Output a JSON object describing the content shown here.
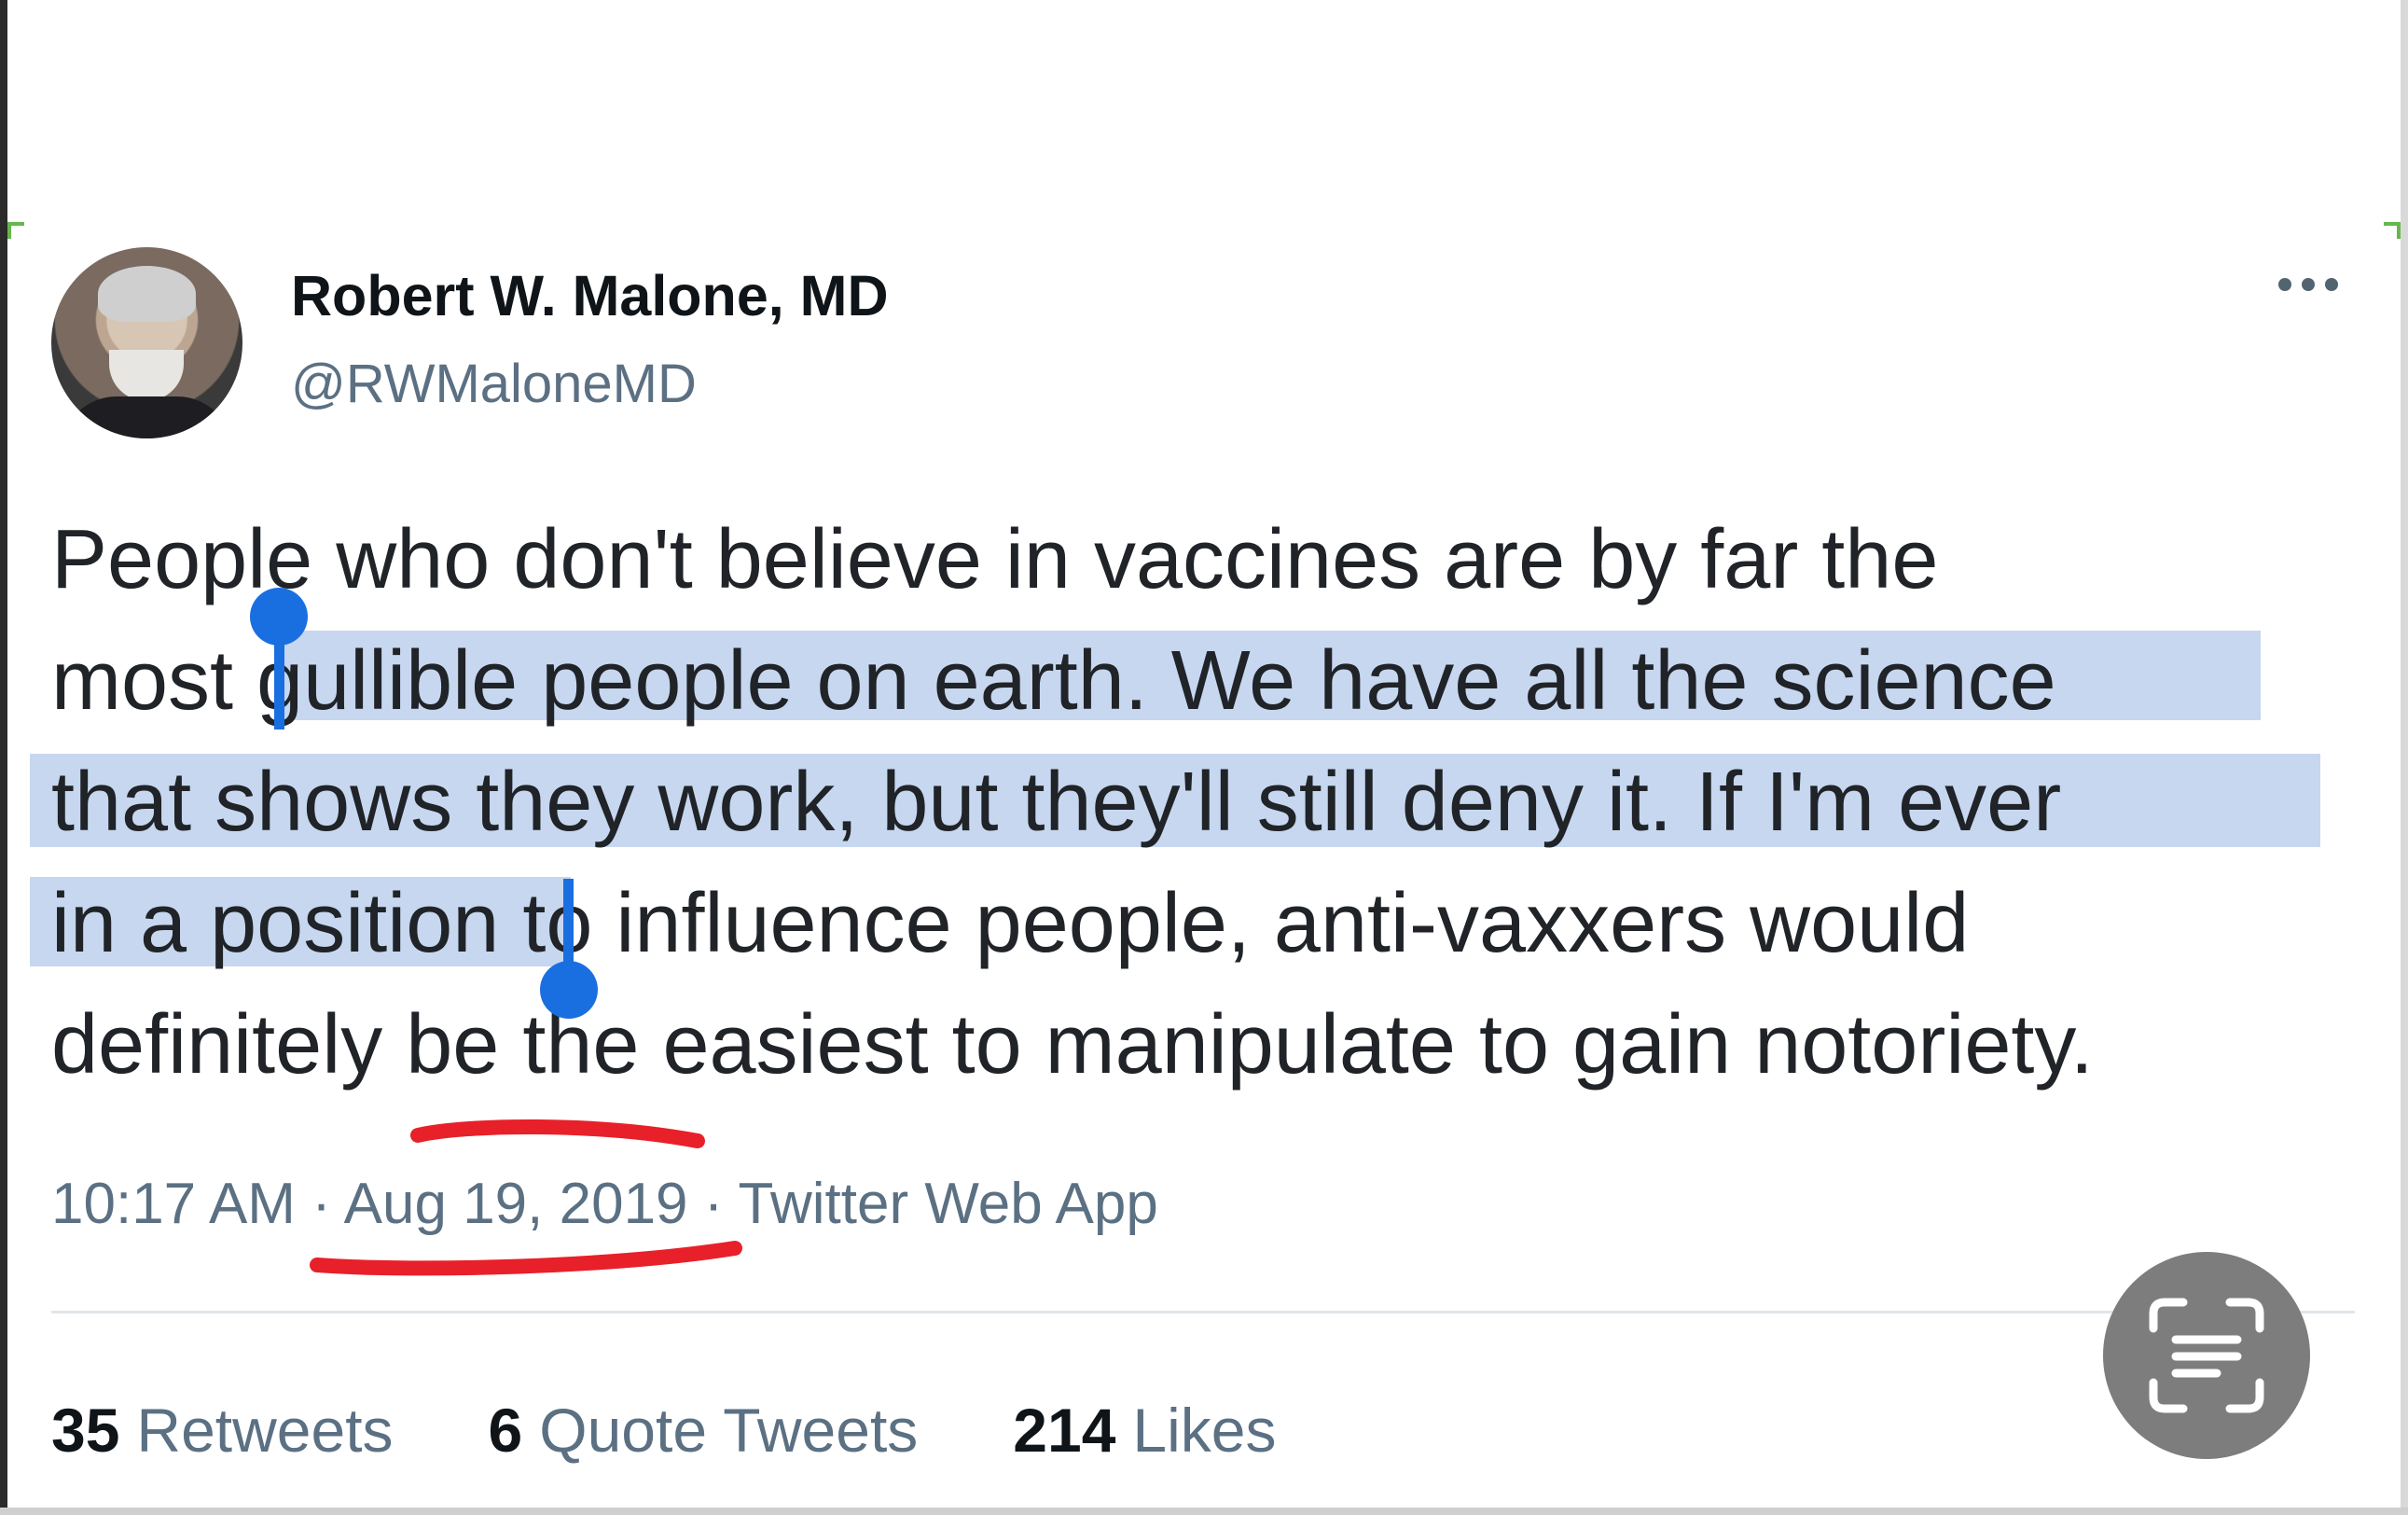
{
  "author": {
    "display_name": "Robert W. Malone, MD",
    "handle": "@RWMaloneMD"
  },
  "tweet": {
    "lines": [
      "People who don't believe in vaccines are by far the",
      "most gullible people on earth. We have all the science",
      "that shows they work, but they'll still deny it. If I'm ever",
      "in a position to influence people, anti-vaxxers would",
      "definitely be the easiest to manipulate to gain notoriety."
    ],
    "selected_text": "gullible people on earth. We have all the science that shows they work, but they'll still deny it. If I'm ever in a position"
  },
  "meta": {
    "time": "10:17 AM",
    "separator": " · ",
    "date": "Aug 19, 2019",
    "source": "Twitter Web App"
  },
  "stats": {
    "retweets": {
      "count": "35",
      "label": "Retweets"
    },
    "quotes": {
      "count": "6",
      "label": "Quote Tweets"
    },
    "likes": {
      "count": "214",
      "label": "Likes"
    }
  },
  "icons": {
    "more": "more-horizontal-icon",
    "scan": "text-scan-icon"
  },
  "colors": {
    "selection": "#c6d7ef",
    "selection_handle": "#1a6fe0",
    "annotation": "#e8202a"
  }
}
